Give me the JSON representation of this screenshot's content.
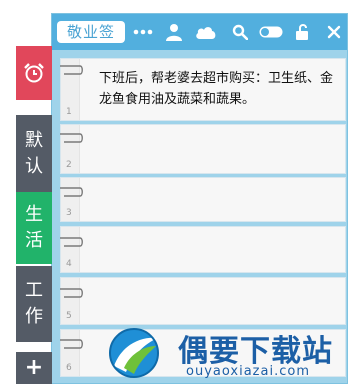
{
  "app": {
    "title": "敬业签"
  },
  "toolbar": {
    "icons": [
      "more-icon",
      "user-icon",
      "cloud-icon",
      "search-icon",
      "toggle-icon",
      "lock-icon",
      "close-icon"
    ]
  },
  "tabs": [
    {
      "icon": "alarm-clock-icon",
      "color": "#e1475b"
    },
    {
      "label": "默认",
      "color": "#545b66"
    },
    {
      "label": "生活",
      "color": "#21b36a"
    },
    {
      "label": "工作",
      "color": "#545b66"
    },
    {
      "label": "+",
      "color": "#545b66"
    }
  ],
  "notes": [
    {
      "number": "1",
      "text": "下班后，帮老婆去超市购买：卫生纸、金龙鱼食用油及蔬菜和蔬果。"
    },
    {
      "number": "2",
      "text": ""
    },
    {
      "number": "3",
      "text": ""
    },
    {
      "number": "4",
      "text": ""
    },
    {
      "number": "5",
      "text": ""
    },
    {
      "number": "6",
      "text": ""
    }
  ],
  "watermark": {
    "title": "偶要下载站",
    "url": "ouyaoxiazai.com"
  }
}
